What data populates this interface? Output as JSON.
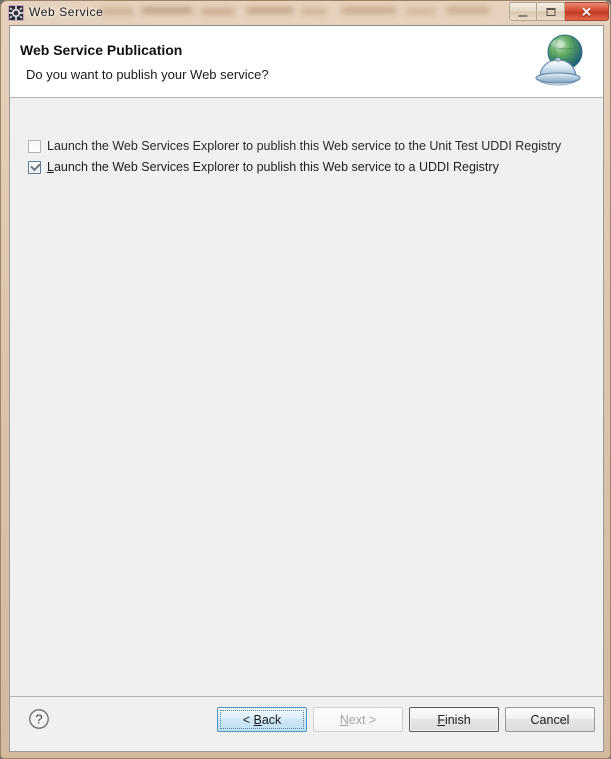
{
  "window": {
    "title": "Web Service",
    "icon": "web-service-gear-icon",
    "caption_buttons": [
      {
        "name": "minimize",
        "glyph": "minimize-icon",
        "label": ""
      },
      {
        "name": "maximize",
        "glyph": "maximize-icon",
        "label": ""
      },
      {
        "name": "close",
        "glyph": "close-icon",
        "label": "✕"
      }
    ]
  },
  "header": {
    "title": "Web Service Publication",
    "subtitle": "Do you want to publish your Web service?",
    "icon": "globe-on-server-icon"
  },
  "options": [
    {
      "label_before_mnemonic": "",
      "mnemonic": "",
      "label": "Launch the Web Services Explorer to publish this Web service to the Unit Test UDDI Registry",
      "checked": false,
      "enabled": false,
      "name": "checkbox-publish-unit-test-uddi-registry"
    },
    {
      "label_before_mnemonic": "",
      "mnemonic": "L",
      "label_after_mnemonic": "aunch the Web Services Explorer to publish this Web service to a UDDI Registry",
      "label": "Launch the Web Services Explorer to publish this Web service to a UDDI Registry",
      "checked": true,
      "enabled": true,
      "name": "checkbox-publish-uddi-registry"
    }
  ],
  "footer": {
    "help_label": "?",
    "buttons": [
      {
        "name": "back-button",
        "label": "< Back",
        "mnemonic": "B",
        "pre": "< ",
        "post": "ack",
        "state": "focused"
      },
      {
        "name": "next-button",
        "label": "Next >",
        "mnemonic": "N",
        "pre": "",
        "post": "ext >",
        "state": "disabled"
      },
      {
        "name": "finish-button",
        "label": "Finish",
        "mnemonic": "F",
        "pre": "",
        "post": "inish",
        "state": "default"
      },
      {
        "name": "cancel-button",
        "label": "Cancel",
        "mnemonic": "",
        "pre": "Cancel",
        "post": "",
        "state": "normal"
      }
    ]
  },
  "colors": {
    "frame": "#dcc6ae",
    "client_bg": "#f0f0f0",
    "header_bg": "#ffffff",
    "accent_focus": "#4a95c4",
    "close_button": "#d2472c",
    "globe_green": "#4f9b52",
    "globe_blue": "#2f6fa8"
  }
}
